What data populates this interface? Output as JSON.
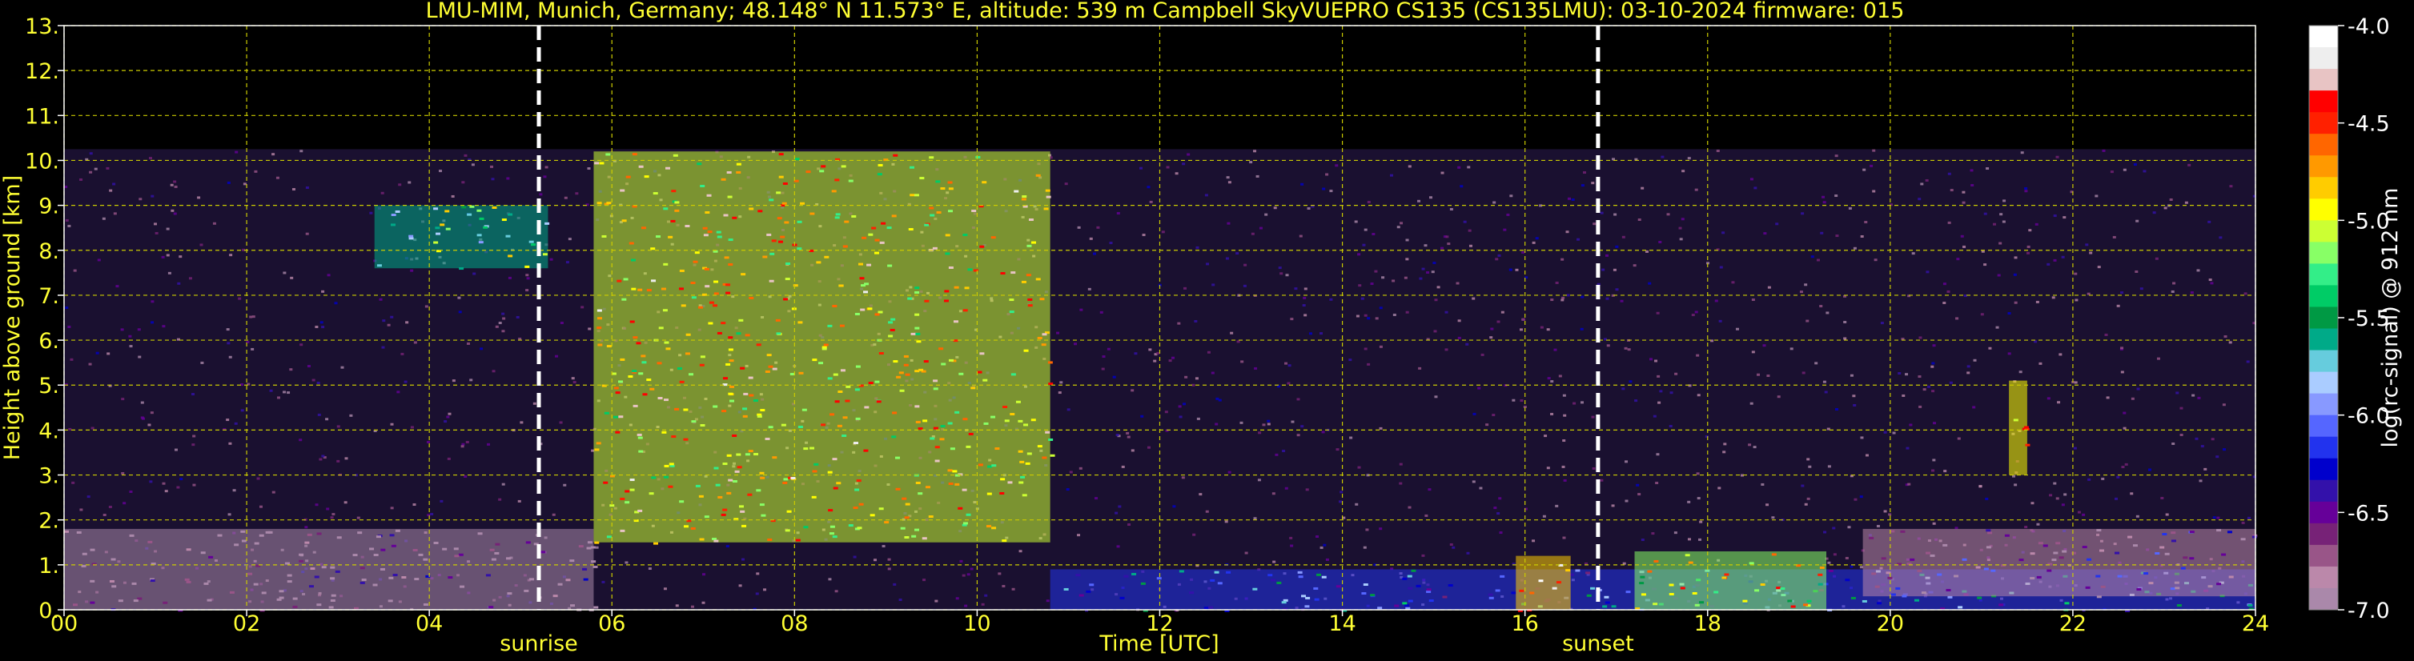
{
  "chart_data": {
    "type": "heatmap",
    "title": "LMU-MIM, Munich, Germany; 48.148° N 11.573° E, altitude: 539 m    Campbell SkyVUEPRO CS135 (CS135LMU): 03-10-2024    firmware: 015",
    "xlabel": "Time [UTC]",
    "ylabel": "Height above ground [km]",
    "xlim": [
      0,
      24
    ],
    "ylim": [
      0,
      13
    ],
    "x_ticks": [
      "00",
      "02",
      "04",
      "06",
      "08",
      "10",
      "12",
      "14",
      "16",
      "18",
      "20",
      "22",
      "24"
    ],
    "y_ticks": [
      "0.",
      "1.",
      "2.",
      "3.",
      "4.",
      "5.",
      "6.",
      "7.",
      "8.",
      "9.",
      "10.",
      "11.",
      "12.",
      "13."
    ],
    "grid": true,
    "colorbar": {
      "label": "log(rc-signal) @ 912 nm",
      "range": [
        -7.0,
        -4.0
      ],
      "ticks": [
        "-4.0",
        "-4.5",
        "-5.0",
        "-5.5",
        "-6.0",
        "-6.5",
        "-7.0"
      ],
      "colors": [
        "#ffffff",
        "#eeeeee",
        "#e8c4c4",
        "#ff0000",
        "#ff2000",
        "#ff6600",
        "#ff9900",
        "#ffcc00",
        "#ffff00",
        "#ccff33",
        "#88ff66",
        "#33ee88",
        "#00cc66",
        "#009944",
        "#00aa88",
        "#66ccdd",
        "#aaccff",
        "#8899ff",
        "#5566ff",
        "#2233ee",
        "#0000cc",
        "#3311aa",
        "#660099",
        "#772277",
        "#995588",
        "#bb88aa",
        "#aa88aa"
      ]
    },
    "markers": [
      {
        "label": "sunrise",
        "x": 5.2
      },
      {
        "label": "sunset",
        "x": 16.8
      }
    ],
    "features": [
      {
        "name": "boundary-layer-night",
        "x_range": [
          0,
          5.8
        ],
        "y_range": [
          0,
          1.8
        ],
        "level": -6.3
      },
      {
        "name": "cirrus-morning",
        "x_range": [
          3.4,
          5.3
        ],
        "y_range": [
          7.6,
          9.0
        ],
        "level": -4.8
      },
      {
        "name": "mid-level-clouds",
        "x_range": [
          5.8,
          10.8
        ],
        "y_range": [
          1.5,
          10.2
        ],
        "level": -4.2
      },
      {
        "name": "surface-layer-day",
        "x_range": [
          10.8,
          24
        ],
        "y_range": [
          0,
          0.9
        ],
        "level": -5.4
      },
      {
        "name": "convective-plume",
        "x_range": [
          15.9,
          16.5
        ],
        "y_range": [
          0,
          1.2
        ],
        "level": -4.0
      },
      {
        "name": "evening-clouds",
        "x_range": [
          17.2,
          19.3
        ],
        "y_range": [
          0,
          1.3
        ],
        "level": -4.4
      },
      {
        "name": "high-cloud-tower",
        "x_range": [
          21.3,
          21.5
        ],
        "y_range": [
          3.0,
          5.1
        ],
        "level": -4.1
      },
      {
        "name": "night-layer",
        "x_range": [
          19.7,
          24
        ],
        "y_range": [
          0.3,
          1.8
        ],
        "level": -6.0
      }
    ]
  }
}
